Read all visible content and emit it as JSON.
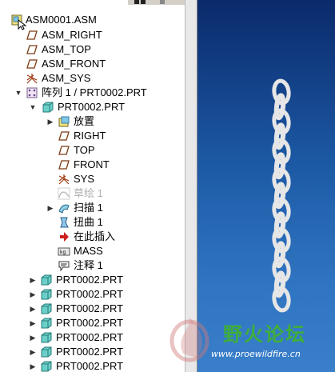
{
  "model_tree": {
    "root": {
      "label": "ASM0001.ASM",
      "icon": "assembly-icon"
    },
    "datum_planes": [
      {
        "label": "ASM_RIGHT",
        "icon": "datum-plane-icon"
      },
      {
        "label": "ASM_TOP",
        "icon": "datum-plane-icon"
      },
      {
        "label": "ASM_FRONT",
        "icon": "datum-plane-icon"
      }
    ],
    "csys": {
      "label": "ASM_SYS",
      "icon": "coordinate-system-icon"
    },
    "pattern": {
      "label": "阵列 1 / PRT0002.PRT",
      "icon": "pattern-icon"
    },
    "first_part": {
      "label": "PRT0002.PRT",
      "children": [
        {
          "label": "放置",
          "icon": "placement-icon",
          "expander": "▶",
          "greyed": false
        },
        {
          "label": "RIGHT",
          "icon": "datum-plane-icon",
          "expander": "",
          "greyed": false
        },
        {
          "label": "TOP",
          "icon": "datum-plane-icon",
          "expander": "",
          "greyed": false
        },
        {
          "label": "FRONT",
          "icon": "datum-plane-icon",
          "expander": "",
          "greyed": false
        },
        {
          "label": "SYS",
          "icon": "coordinate-system-icon",
          "expander": "",
          "greyed": false
        },
        {
          "label": "草绘 1",
          "icon": "sketch-icon",
          "expander": "",
          "greyed": true
        },
        {
          "label": "扫描 1",
          "icon": "sweep-icon",
          "expander": "▶",
          "greyed": false
        },
        {
          "label": "扭曲 1",
          "icon": "twist-icon",
          "expander": "",
          "greyed": false
        },
        {
          "label": "在此插入",
          "icon": "insert-here-arrow-icon",
          "expander": "",
          "greyed": false
        },
        {
          "label": "MASS",
          "icon": "mass-parameter-icon",
          "expander": "",
          "greyed": false
        },
        {
          "label": "注释 1",
          "icon": "annotation-icon",
          "expander": "",
          "greyed": false
        }
      ]
    },
    "collapsed_parts": [
      {
        "label": "PRT0002.PRT"
      },
      {
        "label": "PRT0002.PRT"
      },
      {
        "label": "PRT0002.PRT"
      },
      {
        "label": "PRT0002.PRT"
      },
      {
        "label": "PRT0002.PRT"
      },
      {
        "label": "PRT0002.PRT"
      },
      {
        "label": "PRT0002.PRT"
      }
    ]
  },
  "watermark": {
    "title": "野火论坛",
    "url": "www.proewildfire.cn"
  },
  "colors": {
    "viewport_top": "#0a2a6b",
    "viewport_bottom": "#3a7fca",
    "chain": "#e6e6e6",
    "watermark_green": "#3fae3b"
  }
}
